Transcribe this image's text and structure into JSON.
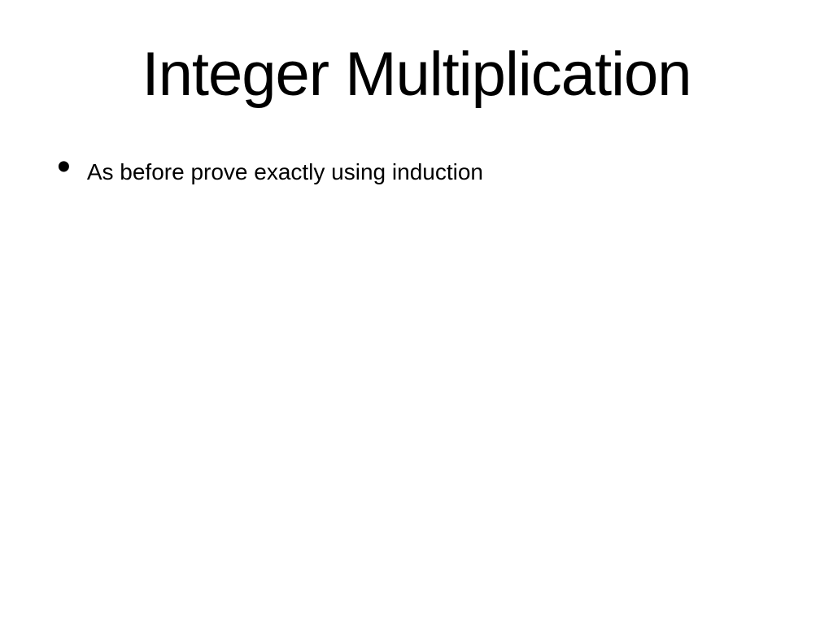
{
  "slide": {
    "title": "Integer Multiplication",
    "bullets": [
      "As before prove exactly using induction"
    ]
  }
}
